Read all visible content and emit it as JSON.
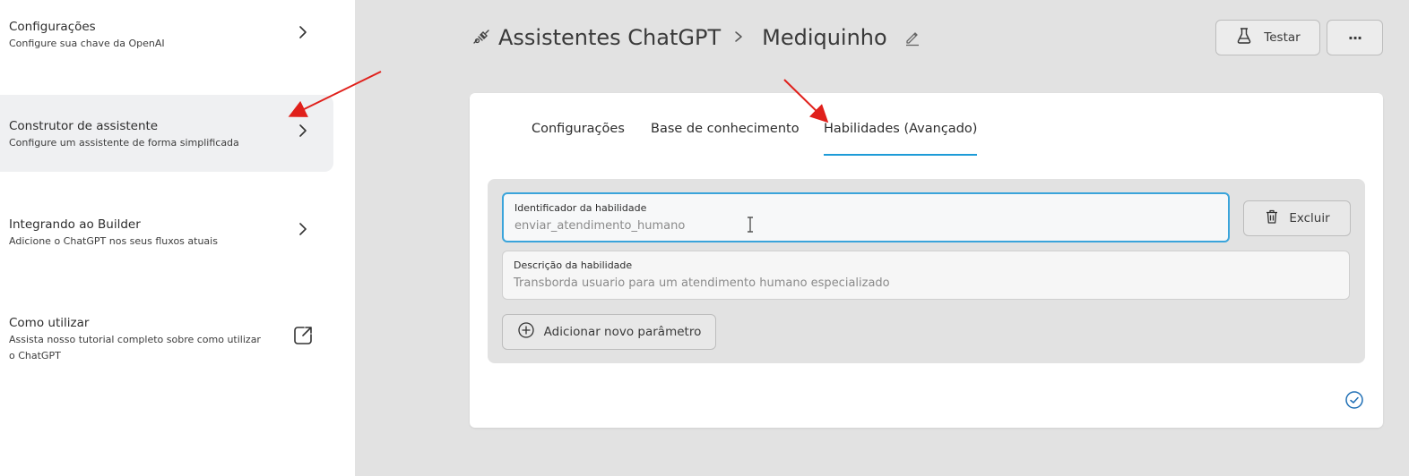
{
  "sidebar": {
    "items": [
      {
        "title": "Configurações",
        "subtitle": "Configure sua chave da OpenAI",
        "icon": "chevron-right-icon"
      },
      {
        "title": "Construtor de assistente",
        "subtitle": "Configure um assistente de forma simplificada",
        "icon": "chevron-right-icon",
        "active": true
      },
      {
        "title": "Integrando ao Builder",
        "subtitle": "Adicione o ChatGPT nos seus fluxos atuais",
        "icon": "chevron-right-icon"
      },
      {
        "title": "Como utilizar",
        "subtitle": "Assista nosso tutorial completo sobre como utilizar o ChatGPT",
        "icon": "external-link-icon"
      }
    ]
  },
  "header": {
    "breadcrumb_root": "Assistentes ChatGPT",
    "breadcrumb_current": "Mediquinho",
    "test_button": "Testar",
    "more_button": "···"
  },
  "tabs": [
    {
      "label": "Configurações"
    },
    {
      "label": "Base de conhecimento"
    },
    {
      "label": "Habilidades (Avançado)",
      "active": true
    }
  ],
  "skill": {
    "identifier_label": "Identificador da habilidade",
    "identifier_value": "enviar_atendimento_humano",
    "description_label": "Descrição da habilidade",
    "description_value": "Transborda usuario para um atendimento humano especializado",
    "delete_button": "Excluir",
    "add_param_button": "Adicionar novo parâmetro"
  },
  "colors": {
    "accent": "#1d9bd7",
    "annotation_arrow": "#e0201b",
    "sidebar_bg": "#ffffff",
    "content_bg": "#e2e2e2"
  }
}
